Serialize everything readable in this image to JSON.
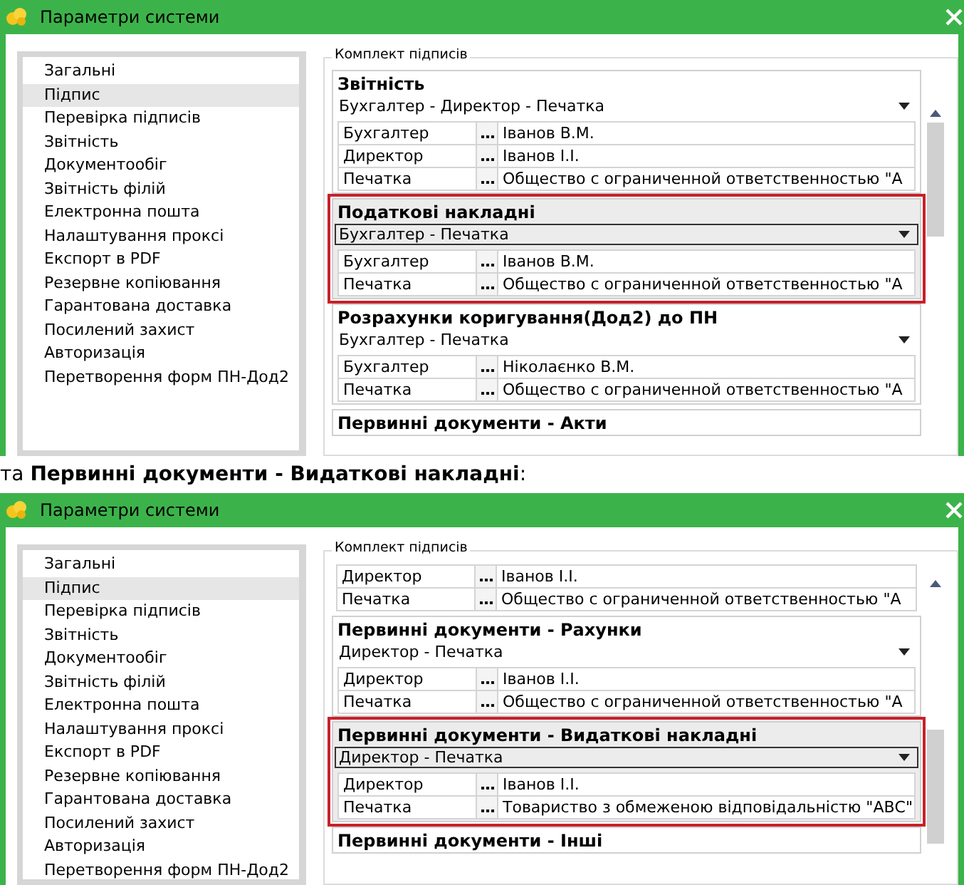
{
  "windows": [
    {
      "title": "Параметри системи",
      "sidebar": {
        "items": [
          {
            "label": "Загальні",
            "selected": false
          },
          {
            "label": "Підпис",
            "selected": true
          },
          {
            "label": "Перевірка підписів",
            "selected": false
          },
          {
            "label": "Звітність",
            "selected": false
          },
          {
            "label": "Документообіг",
            "selected": false
          },
          {
            "label": "Звітність філій",
            "selected": false
          },
          {
            "label": "Електронна пошта",
            "selected": false
          },
          {
            "label": "Налаштування проксі",
            "selected": false
          },
          {
            "label": "Експорт в PDF",
            "selected": false
          },
          {
            "label": "Резервне копіювання",
            "selected": false
          },
          {
            "label": "Гарантована доставка",
            "selected": false
          },
          {
            "label": "Посилений захист",
            "selected": false
          },
          {
            "label": "Авторизація",
            "selected": false
          },
          {
            "label": "Перетворення форм ПН-Дод2",
            "selected": false
          }
        ]
      },
      "legend": "Комплект підписів",
      "groups": [
        {
          "title": "Звітність",
          "combo": "Бухгалтер - Директор - Печатка",
          "selected": false,
          "rows": [
            {
              "role": "Бухгалтер",
              "value": "Іванов В.М."
            },
            {
              "role": "Директор",
              "value": "Іванов І.І."
            },
            {
              "role": "Печатка",
              "value": "Общество с ограниченной ответственностью \"А"
            }
          ]
        },
        {
          "title": "Податкові накладні",
          "combo": "Бухгалтер - Печатка",
          "selected": true,
          "rows": [
            {
              "role": "Бухгалтер",
              "value": "Іванов В.М."
            },
            {
              "role": "Печатка",
              "value": "Общество с ограниченной ответственностью \"А"
            }
          ]
        },
        {
          "title": "Розрахунки коригування(Дод2) до ПН",
          "combo": "Бухгалтер - Печатка",
          "selected": false,
          "rows": [
            {
              "role": "Бухгалтер",
              "value": "Ніколаєнко В.М."
            },
            {
              "role": "Печатка",
              "value": "Общество с ограниченной ответственностью \"А"
            }
          ]
        },
        {
          "title": "Первинні документи - Акти",
          "selected": false
        }
      ]
    },
    {
      "title": "Параметри системи",
      "sidebar": {
        "items": [
          {
            "label": "Загальні",
            "selected": false
          },
          {
            "label": "Підпис",
            "selected": true
          },
          {
            "label": "Перевірка підписів",
            "selected": false
          },
          {
            "label": "Звітність",
            "selected": false
          },
          {
            "label": "Документообіг",
            "selected": false
          },
          {
            "label": "Звітність філій",
            "selected": false
          },
          {
            "label": "Електронна пошта",
            "selected": false
          },
          {
            "label": "Налаштування проксі",
            "selected": false
          },
          {
            "label": "Експорт в PDF",
            "selected": false
          },
          {
            "label": "Резервне копіювання",
            "selected": false
          },
          {
            "label": "Гарантована доставка",
            "selected": false
          },
          {
            "label": "Посилений захист",
            "selected": false
          },
          {
            "label": "Авторизація",
            "selected": false
          },
          {
            "label": "Перетворення форм ПН-Дод2",
            "selected": false
          }
        ]
      },
      "legend": "Комплект підписів",
      "groups": [
        {
          "selected": false,
          "rows": [
            {
              "role": "Директор",
              "value": "Іванов І.І."
            },
            {
              "role": "Печатка",
              "value": "Общество с ограниченной ответственностью \"А"
            }
          ]
        },
        {
          "title": "Первинні документи - Рахунки",
          "combo": "Директор - Печатка",
          "selected": false,
          "rows": [
            {
              "role": "Директор",
              "value": "Іванов І.І."
            },
            {
              "role": "Печатка",
              "value": "Общество с ограниченной ответственностью \"А"
            }
          ]
        },
        {
          "title": "Первинні документи - Видаткові накладні",
          "combo": "Директор - Печатка",
          "selected": true,
          "rows": [
            {
              "role": "Директор",
              "value": "Іванов І.І."
            },
            {
              "role": "Печатка",
              "value": "Товариство з обмеженою відповідальністю \"АВС\""
            }
          ]
        },
        {
          "title": "Первинні документи - Інші",
          "selected": false
        }
      ]
    }
  ],
  "caption": "та **Первинні документи - Видаткові накладні**:"
}
